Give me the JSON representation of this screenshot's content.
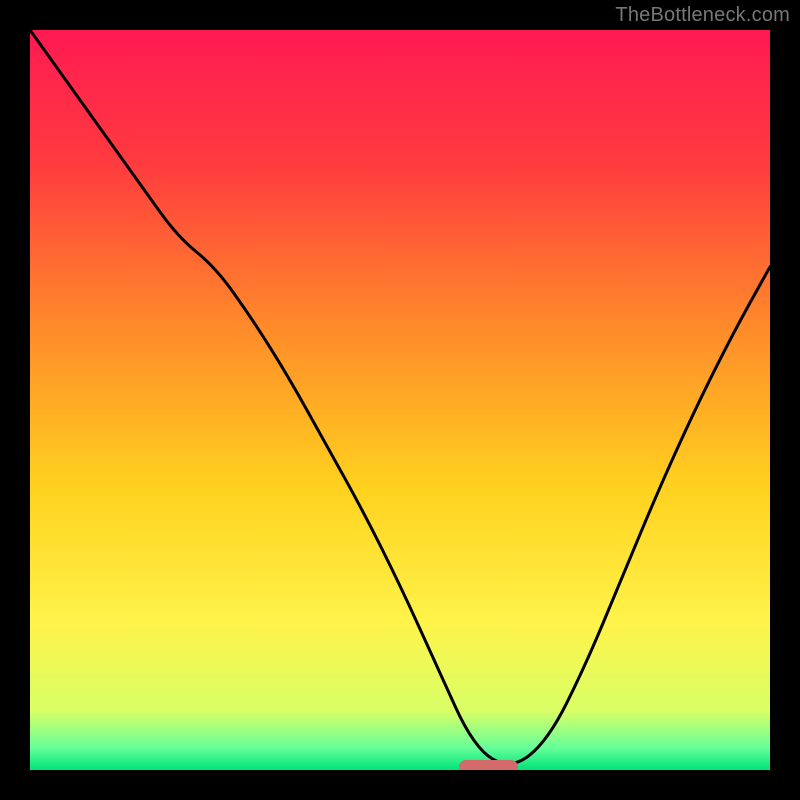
{
  "attribution": "TheBottleneck.com",
  "palette": {
    "gradient_stops": [
      {
        "pct": 0,
        "color": "#ff1a52"
      },
      {
        "pct": 18,
        "color": "#ff3b3f"
      },
      {
        "pct": 40,
        "color": "#ff8a2a"
      },
      {
        "pct": 62,
        "color": "#ffd21f"
      },
      {
        "pct": 80,
        "color": "#fff34a"
      },
      {
        "pct": 92,
        "color": "#d9ff66"
      },
      {
        "pct": 97,
        "color": "#66ff99"
      },
      {
        "pct": 100,
        "color": "#00e37a"
      }
    ],
    "curve_color": "#000000",
    "marker_color": "#d56a6a",
    "background": "#000000"
  },
  "chart_data": {
    "type": "line",
    "title": "",
    "xlabel": "",
    "ylabel": "",
    "xlim": [
      0,
      100
    ],
    "ylim": [
      0,
      100
    ],
    "grid": false,
    "legend": false,
    "x": [
      0,
      5,
      10,
      15,
      20,
      25,
      30,
      35,
      40,
      45,
      50,
      55,
      60,
      65,
      70,
      75,
      80,
      85,
      90,
      95,
      100
    ],
    "values": [
      100,
      93,
      86,
      79,
      72,
      68,
      61,
      53,
      44,
      35,
      25,
      14,
      3,
      0,
      4,
      14,
      26,
      38,
      49,
      59,
      68
    ],
    "marker": {
      "x_start": 58,
      "x_end": 66,
      "y": 0
    }
  }
}
